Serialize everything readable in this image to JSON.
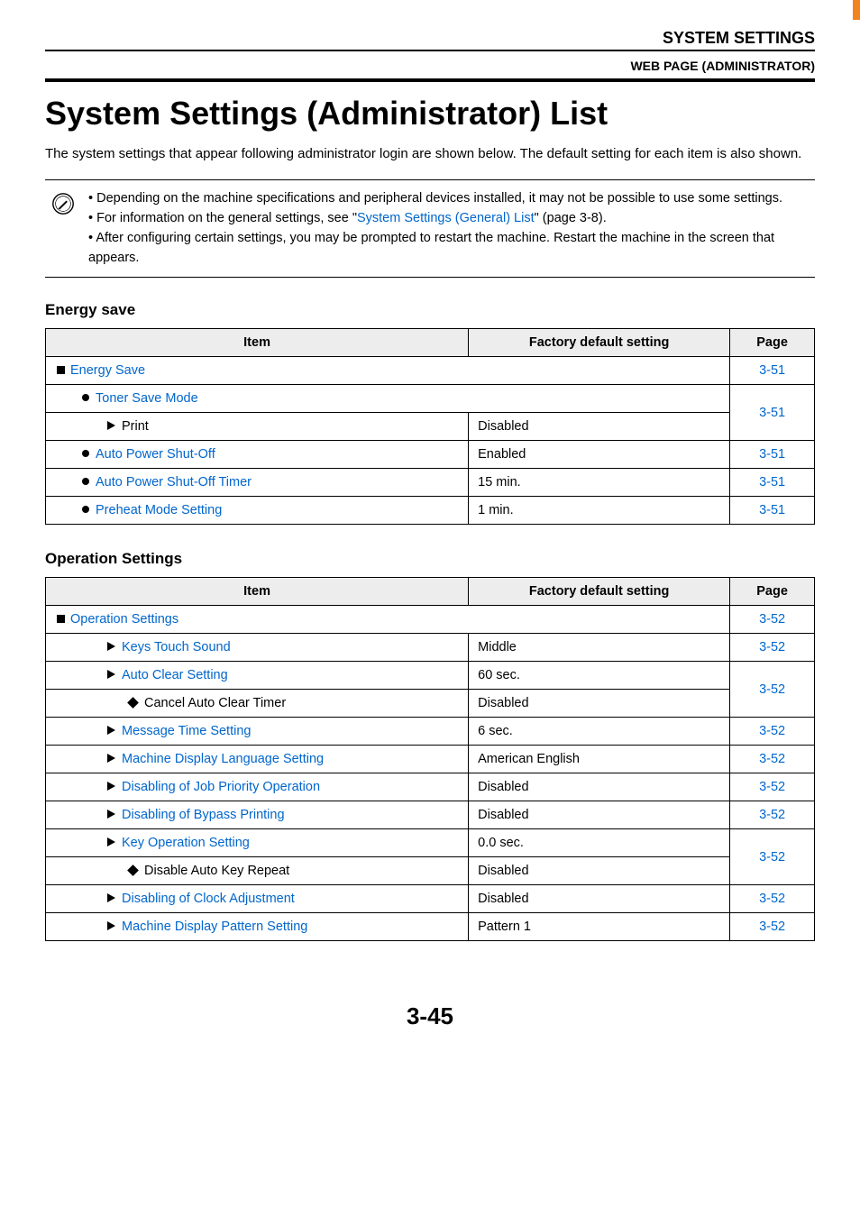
{
  "header": {
    "title": "SYSTEM SETTINGS",
    "subtitle": "WEB PAGE (ADMINISTRATOR)"
  },
  "page": {
    "h1": "System Settings (Administrator) List",
    "intro": "The system settings that appear following administrator login are shown below. The default setting for each item is also shown.",
    "footer": "3-45"
  },
  "notes": {
    "n1": "Depending on the machine specifications and peripheral devices installed, it may not be possible to use some settings.",
    "n2a": "For information on the general settings, see \"",
    "n2link": "System Settings (General) List",
    "n2b": "\" (page 3-8).",
    "n3": "After configuring certain settings, you may be prompted to restart the machine. Restart the machine in the screen that appears."
  },
  "cols": {
    "item": "Item",
    "fds": "Factory default setting",
    "page": "Page"
  },
  "energy": {
    "heading": "Energy save",
    "root": "Energy Save",
    "root_page": "3-51",
    "toner": "Toner Save Mode",
    "print": "Print",
    "print_v": "Disabled",
    "print_page": "3-51",
    "apo": "Auto Power Shut-Off",
    "apo_v": "Enabled",
    "apo_page": "3-51",
    "apot": "Auto Power Shut-Off Timer",
    "apot_v": "15 min.",
    "apot_page": "3-51",
    "pre": "Preheat Mode Setting",
    "pre_v": "1 min.",
    "pre_page": "3-51"
  },
  "op": {
    "heading": "Operation Settings",
    "root": "Operation Settings",
    "root_page": "3-52",
    "keys": "Keys Touch Sound",
    "keys_v": "Middle",
    "keys_page": "3-52",
    "auto": "Auto Clear Setting",
    "auto_v": "60 sec.",
    "cancel": "Cancel Auto Clear Timer",
    "cancel_v": "Disabled",
    "auto_page": "3-52",
    "msg": "Message Time Setting",
    "msg_v": "6 sec.",
    "msg_page": "3-52",
    "lang": "Machine Display Language Setting",
    "lang_v": "American English",
    "lang_page": "3-52",
    "djp": "Disabling of Job Priority Operation",
    "djp_v": "Disabled",
    "djp_page": "3-52",
    "dbp": "Disabling of Bypass Printing",
    "dbp_v": "Disabled",
    "dbp_page": "3-52",
    "keyop": "Key Operation Setting",
    "keyop_v": "0.0 sec.",
    "dakr": "Disable Auto Key Repeat",
    "dakr_v": "Disabled",
    "keyop_page": "3-52",
    "dca": "Disabling of Clock Adjustment",
    "dca_v": "Disabled",
    "dca_page": "3-52",
    "pat": "Machine Display Pattern Setting",
    "pat_v": "Pattern 1",
    "pat_page": "3-52"
  }
}
